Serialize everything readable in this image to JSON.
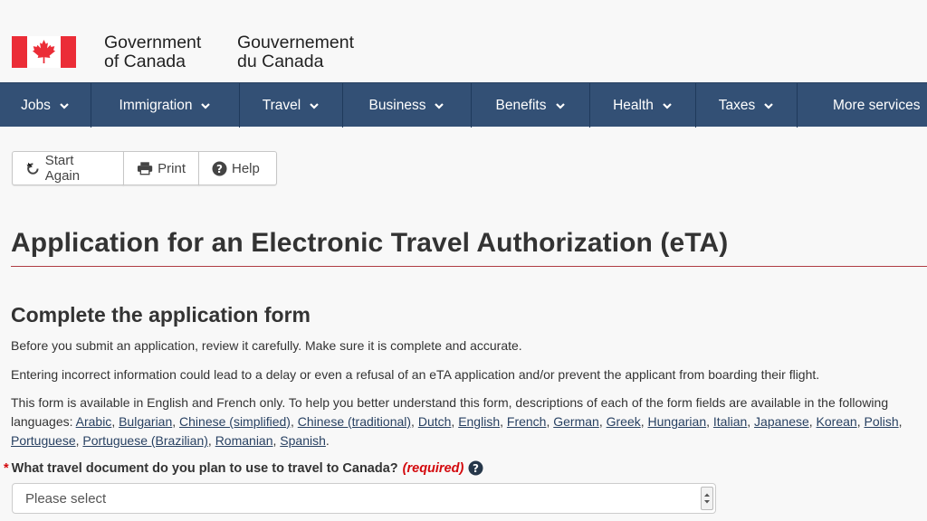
{
  "header": {
    "signature_en_line1": "Government",
    "signature_en_line2": "of Canada",
    "signature_fr_line1": "Gouvernement",
    "signature_fr_line2": "du Canada",
    "flag_color": "#eb2d37"
  },
  "nav": {
    "items": [
      {
        "label": "Jobs"
      },
      {
        "label": "Immigration"
      },
      {
        "label": "Travel"
      },
      {
        "label": "Business"
      },
      {
        "label": "Benefits"
      },
      {
        "label": "Health"
      },
      {
        "label": "Taxes"
      },
      {
        "label": "More services"
      }
    ],
    "background": "#335075"
  },
  "toolbar": {
    "start_again": "Start Again",
    "print": "Print",
    "help": "Help"
  },
  "page": {
    "title": "Application for an Electronic Travel Authorization (eTA)",
    "section_heading": "Complete the application form",
    "para1": "Before you submit an application, review it carefully. Make sure it is complete and accurate.",
    "para2": "Entering incorrect information could lead to a delay or even a refusal of an eTA application and/or prevent the applicant from boarding their flight.",
    "para3": "This form is available in English and French only. To help you better understand this form, descriptions of each of the form fields are available in the following",
    "languages_prefix": "languages: ",
    "languages": [
      "Arabic",
      "Bulgarian",
      "Chinese (simplified)",
      "Chinese (traditional)",
      "Dutch",
      "English",
      "French",
      "German",
      "Greek",
      "Hungarian",
      "Italian",
      "Japanese",
      "Korean",
      "Polish",
      "Portuguese",
      "Portuguese (Brazilian)",
      "Romanian",
      "Spanish"
    ]
  },
  "question": {
    "asterisk": "*",
    "label": "What travel document do you plan to use to travel to Canada?",
    "required": "(required)",
    "select_value": "Please select"
  }
}
